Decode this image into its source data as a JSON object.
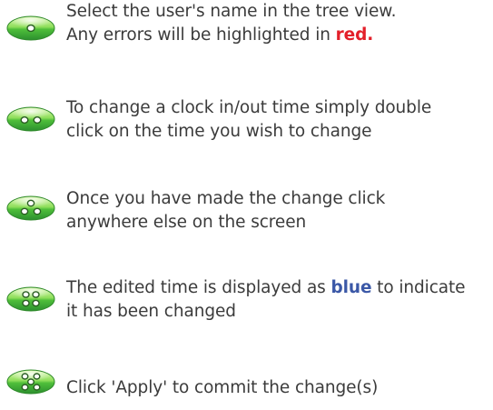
{
  "colors": {
    "text": "#3b3b3b",
    "error_highlight": "#e3202a",
    "edited_highlight": "#3b58a7",
    "icon_green": "#3aa640",
    "icon_green_light": "#8ede5b"
  },
  "steps": [
    {
      "icon": "green-oval-one-dot-icon",
      "line1": "Select the user's name in the tree view.",
      "line2_before": "Any errors will be highlighted in ",
      "line2_highlight": "red.",
      "line2_after": ""
    },
    {
      "icon": "green-oval-two-dots-icon",
      "line1": "To change a clock in/out time simply double",
      "line2_before": "click on the time you wish to change",
      "line2_highlight": "",
      "line2_after": ""
    },
    {
      "icon": "green-oval-three-dots-icon",
      "line1": "Once you have made the change click",
      "line2_before": "anywhere else on the screen",
      "line2_highlight": "",
      "line2_after": ""
    },
    {
      "icon": "green-oval-four-dots-icon",
      "line1_before": "The edited time is displayed as ",
      "line1_highlight": "blue",
      "line1_after": " to indicate",
      "line2_before": "it has been changed",
      "line2_highlight": "",
      "line2_after": ""
    },
    {
      "icon": "green-oval-five-dots-icon",
      "line1": "Click 'Apply' to commit the change(s)"
    }
  ]
}
